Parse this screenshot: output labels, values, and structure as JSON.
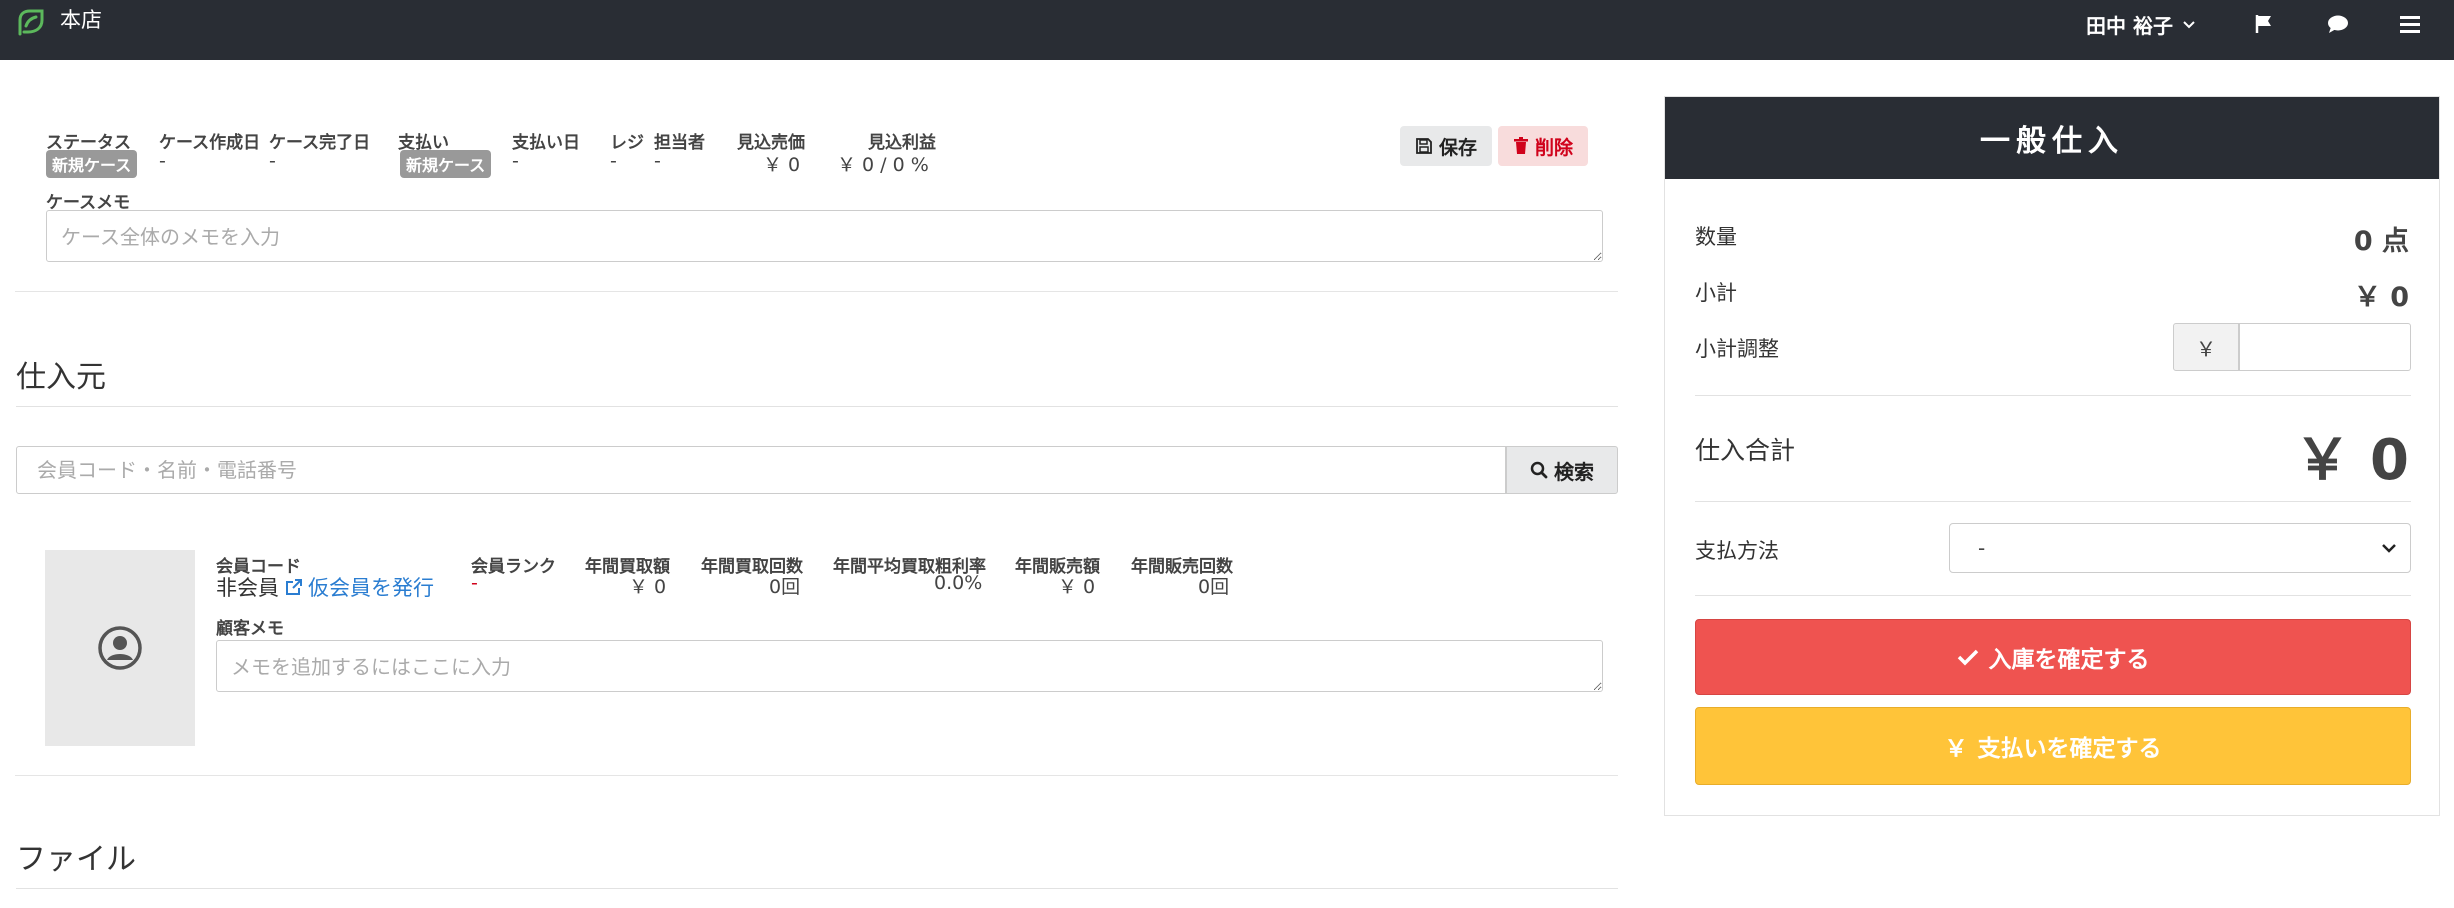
{
  "header": {
    "store_name": "本店",
    "user_name": "田中 裕子",
    "icons": [
      "logo-icon",
      "chevron-down-icon",
      "flag-icon",
      "chat-icon",
      "menu-icon"
    ]
  },
  "case": {
    "fields": [
      {
        "label": "ステータス",
        "badge": "新規ケース"
      },
      {
        "label": "ケース作成日",
        "value": "-"
      },
      {
        "label": "ケース完了日",
        "value": "-"
      },
      {
        "label": "支払い",
        "badge": "新規ケース"
      },
      {
        "label": "支払い日",
        "value": "-"
      },
      {
        "label": "レジ",
        "value": "-"
      },
      {
        "label": "担当者",
        "value": "-"
      },
      {
        "label": "見込売価",
        "value": "￥ 0"
      },
      {
        "label": "見込利益",
        "value": "￥ 0 / 0 %"
      }
    ],
    "save_label": "保存",
    "delete_label": "削除",
    "memo_label": "ケースメモ",
    "memo_placeholder": "ケース全体のメモを入力"
  },
  "supplier": {
    "title": "仕入元",
    "search_placeholder": "会員コード・名前・電話番号",
    "search_label": "検索",
    "member": {
      "code_label": "会員コード",
      "code_value": "非会員",
      "issue_link": "仮会員を発行",
      "rank_label": "会員ランク",
      "rank_value": "-",
      "stats": [
        {
          "label": "年間買取額",
          "value": "￥ 0"
        },
        {
          "label": "年間買取回数",
          "value": "0回"
        },
        {
          "label": "年間平均買取粗利率",
          "value": "0.0%"
        },
        {
          "label": "年間販売額",
          "value": "￥ 0"
        },
        {
          "label": "年間販売回数",
          "value": "0回"
        }
      ],
      "memo_label": "顧客メモ",
      "memo_placeholder": "メモを追加するにはここに入力"
    }
  },
  "files": {
    "title": "ファイル"
  },
  "panel": {
    "title": "一般仕入",
    "quantity_label": "数量",
    "quantity_value": "0 点",
    "subtotal_label": "小計",
    "subtotal_value": "￥ 0",
    "adjust_label": "小計調整",
    "adjust_currency": "￥",
    "adjust_value": "",
    "total_label": "仕入合計",
    "total_value": "￥ 0",
    "payment_label": "支払方法",
    "payment_selected": "-",
    "confirm_label": "入庫を確定する",
    "pay_label": "支払いを確定する",
    "pay_icon_glyph": "￥"
  },
  "colors": {
    "header_bg": "#292d34",
    "confirm_bg": "#ef5350",
    "pay_bg": "#ffc439",
    "delete_fg": "#d0021b",
    "link": "#2a7dd1",
    "badge_bg": "#999999"
  }
}
